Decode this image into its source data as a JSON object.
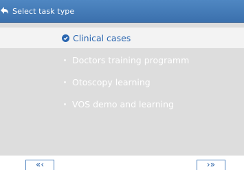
{
  "header": {
    "title": "Select task type",
    "back_icon": "back-arrow-icon",
    "background": "#3b70ad"
  },
  "list": {
    "items": [
      {
        "label": "Clinical cases",
        "selected": true
      },
      {
        "label": "Doctors training programm",
        "selected": false
      },
      {
        "label": "Otoscopy learning",
        "selected": false
      },
      {
        "label": "VOS demo and learning",
        "selected": false
      }
    ],
    "selected_color": "#2a66b0",
    "selected_icon": "checkmark-circle-icon",
    "bullet_icon": "bullet-dot-icon"
  },
  "footer": {
    "prev_label": "«‹",
    "next_label": "›»"
  }
}
